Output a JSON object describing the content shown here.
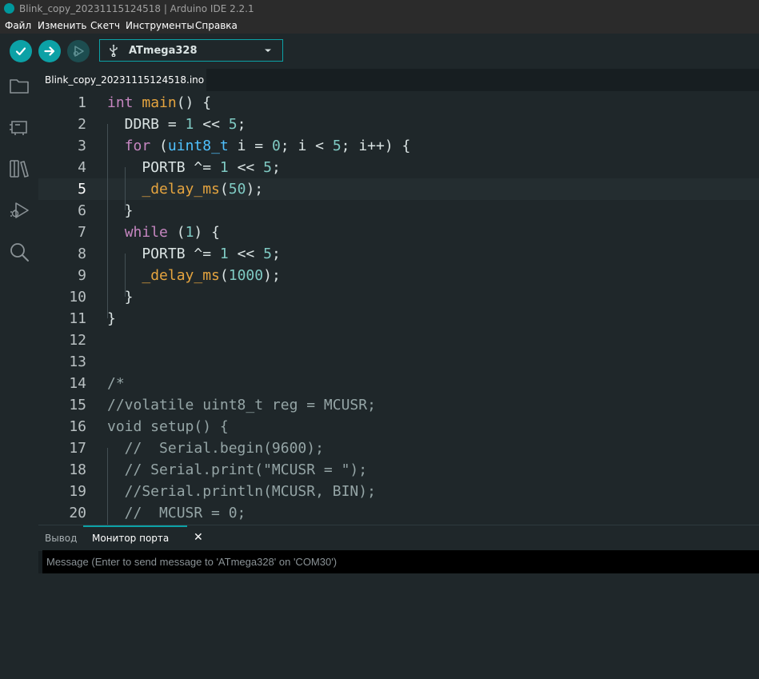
{
  "window": {
    "title": "Blink_copy_20231115124518 | Arduino IDE 2.2.1"
  },
  "menu": {
    "items": [
      "Файл",
      "Изменить",
      "Скетч",
      "Инструменты",
      "Справка"
    ]
  },
  "toolbar": {
    "board": "ATmega328",
    "icons": [
      "verify-icon",
      "upload-icon",
      "debug-icon",
      "usb-icon",
      "chevron-down-icon"
    ]
  },
  "sidebar": {
    "icons": [
      "folder-icon",
      "boards-manager-icon",
      "library-icon",
      "debug-icon",
      "search-icon"
    ]
  },
  "tabs": {
    "active": "Blink_copy_20231115124518.ino"
  },
  "editor": {
    "current_line": 5,
    "lines": [
      {
        "n": "1",
        "tokens": [
          [
            "int",
            "kw"
          ],
          [
            " ",
            "plain"
          ],
          [
            "main",
            "fn"
          ],
          [
            "() {",
            "plain"
          ]
        ]
      },
      {
        "n": "2",
        "tokens": [
          [
            "  DDRB = ",
            "plain"
          ],
          [
            "1",
            "num"
          ],
          [
            " << ",
            "plain"
          ],
          [
            "5",
            "num"
          ],
          [
            ";",
            "plain"
          ]
        ]
      },
      {
        "n": "3",
        "tokens": [
          [
            "  ",
            "plain"
          ],
          [
            "for",
            "kw"
          ],
          [
            " (",
            "plain"
          ],
          [
            "uint8_t",
            "type"
          ],
          [
            " i = ",
            "plain"
          ],
          [
            "0",
            "num"
          ],
          [
            "; i < ",
            "plain"
          ],
          [
            "5",
            "num"
          ],
          [
            "; i++) {",
            "plain"
          ]
        ]
      },
      {
        "n": "4",
        "tokens": [
          [
            "    PORTB ^= ",
            "plain"
          ],
          [
            "1",
            "num"
          ],
          [
            " << ",
            "plain"
          ],
          [
            "5",
            "num"
          ],
          [
            ";",
            "plain"
          ]
        ]
      },
      {
        "n": "5",
        "tokens": [
          [
            "    ",
            "plain"
          ],
          [
            "_delay_ms",
            "fn"
          ],
          [
            "(",
            "plain"
          ],
          [
            "50",
            "num"
          ],
          [
            ");",
            "plain"
          ]
        ]
      },
      {
        "n": "6",
        "tokens": [
          [
            "  }",
            "plain"
          ]
        ]
      },
      {
        "n": "7",
        "tokens": [
          [
            "  ",
            "plain"
          ],
          [
            "while",
            "kw"
          ],
          [
            " (",
            "plain"
          ],
          [
            "1",
            "num"
          ],
          [
            ") {",
            "plain"
          ]
        ]
      },
      {
        "n": "8",
        "tokens": [
          [
            "    PORTB ^= ",
            "plain"
          ],
          [
            "1",
            "num"
          ],
          [
            " << ",
            "plain"
          ],
          [
            "5",
            "num"
          ],
          [
            ";",
            "plain"
          ]
        ]
      },
      {
        "n": "9",
        "tokens": [
          [
            "    ",
            "plain"
          ],
          [
            "_delay_ms",
            "fn"
          ],
          [
            "(",
            "plain"
          ],
          [
            "1000",
            "num"
          ],
          [
            ");",
            "plain"
          ]
        ]
      },
      {
        "n": "10",
        "tokens": [
          [
            "  }",
            "plain"
          ]
        ]
      },
      {
        "n": "11",
        "tokens": [
          [
            "}",
            "plain"
          ]
        ]
      },
      {
        "n": "12",
        "tokens": []
      },
      {
        "n": "13",
        "tokens": []
      },
      {
        "n": "14",
        "tokens": [
          [
            "/*",
            "comment"
          ]
        ]
      },
      {
        "n": "15",
        "tokens": [
          [
            "//volatile uint8_t reg = MCUSR;",
            "comment"
          ]
        ]
      },
      {
        "n": "16",
        "tokens": [
          [
            "void setup() {",
            "comment"
          ]
        ]
      },
      {
        "n": "17",
        "tokens": [
          [
            "  //  Serial.begin(9600);",
            "comment"
          ]
        ]
      },
      {
        "n": "18",
        "tokens": [
          [
            "  // Serial.print(\"MCUSR = \");",
            "comment"
          ]
        ]
      },
      {
        "n": "19",
        "tokens": [
          [
            "  //Serial.println(MCUSR, BIN);",
            "comment"
          ]
        ]
      },
      {
        "n": "20",
        "tokens": [
          [
            "  //  MCUSR = 0;",
            "comment"
          ]
        ]
      }
    ]
  },
  "bottom_panel": {
    "tabs": [
      "Вывод",
      "Монитор порта"
    ],
    "active_tab": "Монитор порта",
    "close_glyph": "✕",
    "message_placeholder": "Message (Enter to send message to 'ATmega328' on 'COM30')",
    "message_value": ""
  },
  "colors": {
    "accent": "#0ca1a6",
    "keyword": "#c586c0",
    "type": "#4fc1ff",
    "function": "#e5a43f",
    "number": "#7fcac3",
    "comment": "#95a5a6"
  }
}
